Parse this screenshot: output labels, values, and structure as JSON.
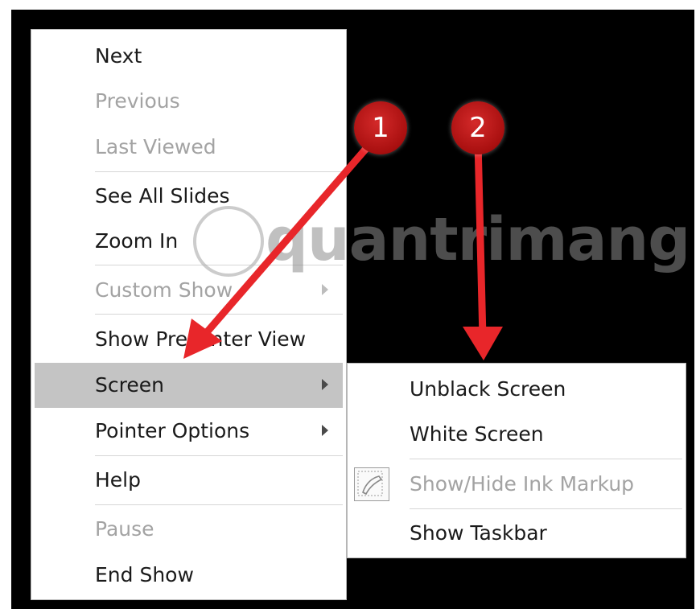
{
  "context_menu": {
    "items": [
      {
        "label": "Next",
        "state": "enabled"
      },
      {
        "label": "Previous",
        "state": "disabled"
      },
      {
        "label": "Last Viewed",
        "state": "disabled"
      },
      {
        "label": "See All Slides",
        "state": "enabled"
      },
      {
        "label": "Zoom In",
        "state": "enabled"
      },
      {
        "label": "Custom Show",
        "state": "disabled",
        "submenu": true
      },
      {
        "label": "Show Presenter View",
        "state": "enabled"
      },
      {
        "label": "Screen",
        "state": "highlighted",
        "submenu": true
      },
      {
        "label": "Pointer Options",
        "state": "enabled",
        "submenu": true
      },
      {
        "label": "Help",
        "state": "enabled"
      },
      {
        "label": "Pause",
        "state": "disabled"
      },
      {
        "label": "End Show",
        "state": "enabled"
      }
    ]
  },
  "screen_submenu": {
    "items": [
      {
        "label": "Unblack Screen",
        "state": "enabled"
      },
      {
        "label": "White Screen",
        "state": "enabled"
      },
      {
        "label": "Show/Hide Ink Markup",
        "state": "disabled",
        "icon": "ink-markup-icon"
      },
      {
        "label": "Show Taskbar",
        "state": "enabled"
      }
    ]
  },
  "annotations": {
    "badge_1": "1",
    "badge_2": "2",
    "arrow_color": "#e8262a"
  },
  "watermark": {
    "text": "quantrimang"
  },
  "colors": {
    "background": "#000000",
    "menu_bg": "#ffffff",
    "highlight": "#c4c4c4",
    "disabled_text": "#a3a3a3",
    "badge_red": "#b81414"
  }
}
